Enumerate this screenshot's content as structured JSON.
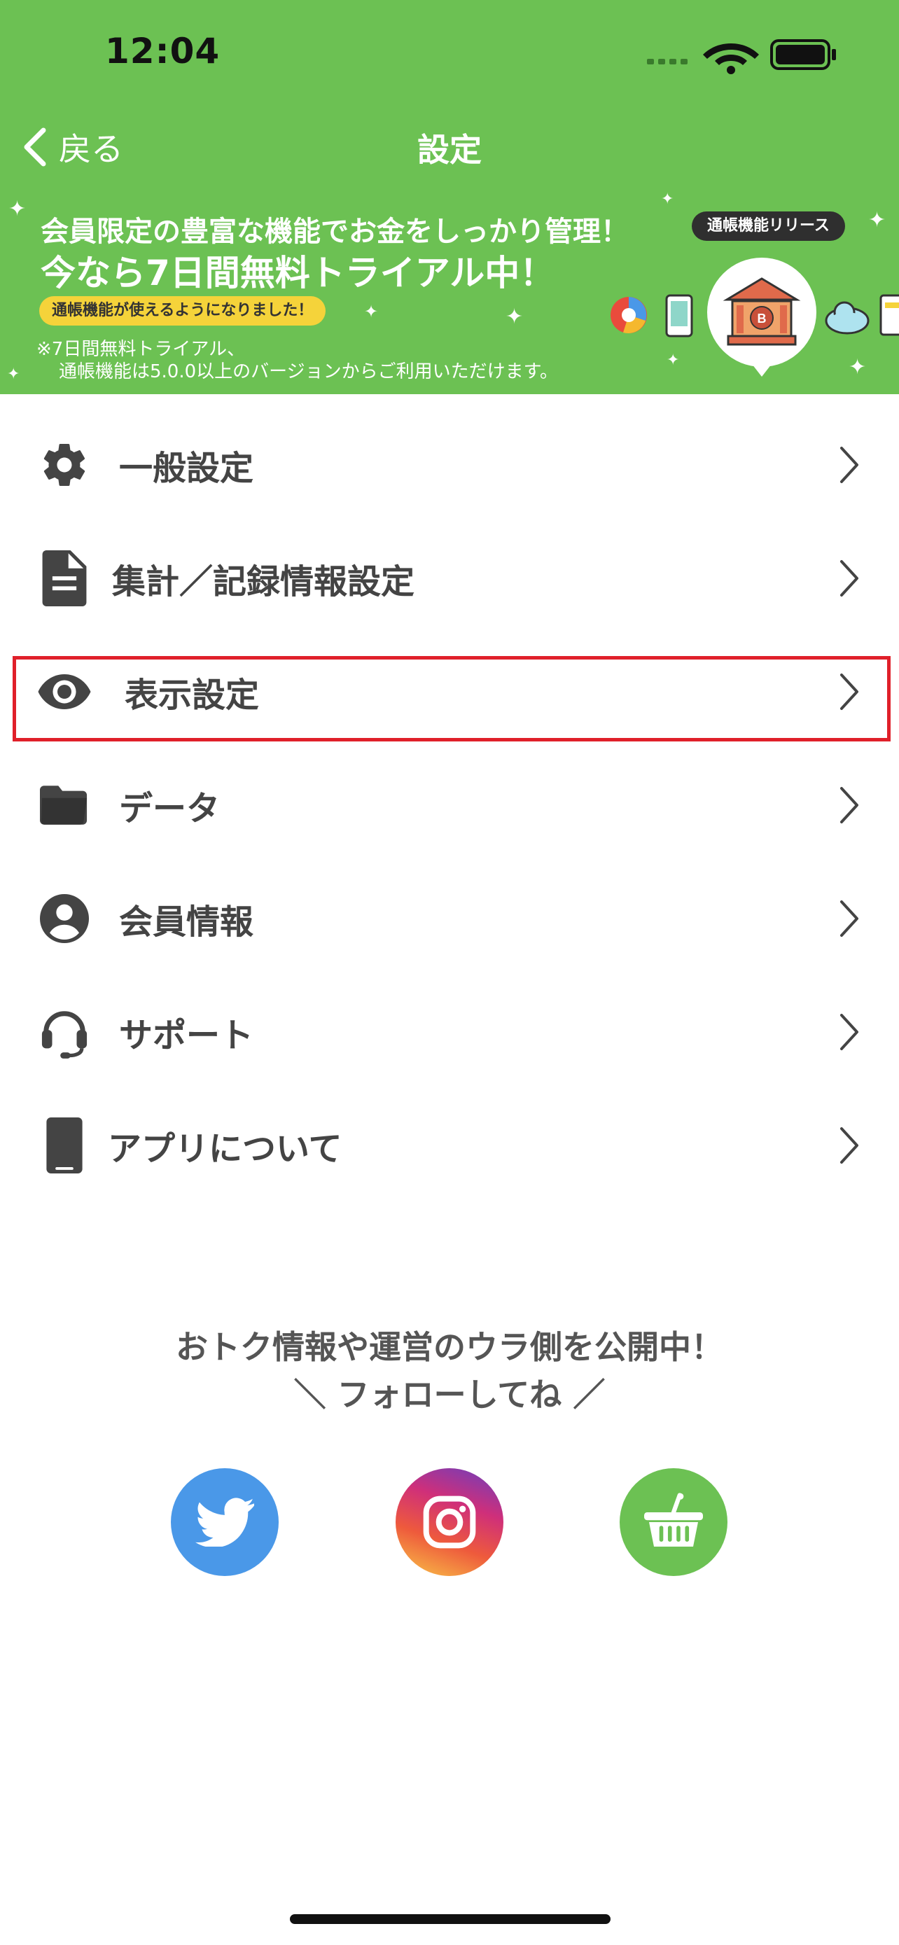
{
  "status_bar": {
    "time": "12:04"
  },
  "navbar": {
    "back_label": "戻る",
    "title": "設定"
  },
  "banner": {
    "headline1": "会員限定の豊富な機能でお金をしっかり管理！",
    "headline2": "今なら7日間無料トライアル中！",
    "pill": "通帳機能が使えるようになりました！",
    "note1": "※7日間無料トライアル、",
    "note2": "通帳機能は5.0.0以上のバージョンからご利用いただけます。",
    "release_badge": "通帳機能リリース",
    "bank_letter": "B"
  },
  "menu": {
    "items": [
      {
        "label": "一般設定",
        "icon": "gear-icon"
      },
      {
        "label": "集計／記録情報設定",
        "icon": "document-icon"
      },
      {
        "label": "表示設定",
        "icon": "eye-icon",
        "highlighted": true
      },
      {
        "label": "データ",
        "icon": "folder-icon"
      },
      {
        "label": "会員情報",
        "icon": "user-circle-icon"
      },
      {
        "label": "サポート",
        "icon": "headset-icon"
      },
      {
        "label": "アプリについて",
        "icon": "smartphone-icon"
      }
    ]
  },
  "follow": {
    "line1": "おトク情報や運営のウラ側を公開中！",
    "line2": "＼ フォローしてね ／"
  },
  "colors": {
    "brand_green": "#6cc153",
    "highlight_red": "#e0202a",
    "twitter_blue": "#4a98e8",
    "pill_yellow": "#f5d33a"
  }
}
